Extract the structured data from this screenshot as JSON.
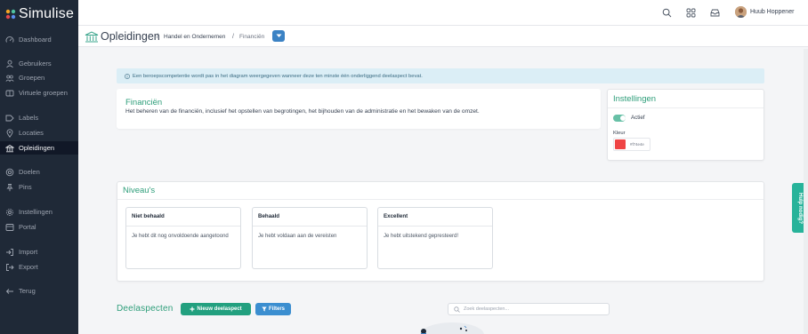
{
  "app": {
    "name": "Simulise"
  },
  "sidebar": {
    "items": [
      {
        "label": "Dashboard",
        "icon": "dashboard-icon"
      },
      {
        "label": "Gebruikers",
        "icon": "user-icon"
      },
      {
        "label": "Groepen",
        "icon": "group-icon"
      },
      {
        "label": "Virtuele groepen",
        "icon": "virtual-group-icon"
      },
      {
        "label": "Labels",
        "icon": "tag-icon"
      },
      {
        "label": "Locaties",
        "icon": "location-icon"
      },
      {
        "label": "Opleidingen",
        "icon": "education-icon",
        "active": true
      },
      {
        "label": "Doelen",
        "icon": "target-icon"
      },
      {
        "label": "Pins",
        "icon": "pin-icon"
      },
      {
        "label": "Instellingen",
        "icon": "gear-icon"
      },
      {
        "label": "Portal",
        "icon": "portal-icon"
      },
      {
        "label": "Import",
        "icon": "import-icon"
      },
      {
        "label": "Export",
        "icon": "export-icon"
      },
      {
        "label": "Terug",
        "icon": "back-arrow-icon"
      }
    ]
  },
  "topbar": {
    "icons": [
      "search-icon",
      "grid-apps-icon",
      "inbox-icon"
    ],
    "user_name": "Huub Hoppener"
  },
  "breadcrumb": {
    "title": "Opleidingen",
    "items": [
      "Handel en Ondernemen",
      "Financiën"
    ],
    "separator": "/"
  },
  "info_banner": {
    "text": "Een beroepscompetentie wordt pas in het diagram weergegeven wanneer deze ten minste één onderliggend deelaspect bevat."
  },
  "competence": {
    "title": "Financiën",
    "description": "Het beheren van de financiën, inclusief het opstellen van begrotingen, het bijhouden van de administratie en het bewaken van de omzet."
  },
  "settings": {
    "title": "Instellingen",
    "active_label": "Actief",
    "active": true,
    "color_label": "Kleur",
    "color_value": "#f74e4e",
    "swatch_color": "#ef4444"
  },
  "levels": {
    "title": "Niveau's",
    "items": [
      {
        "title": "Niet behaald",
        "text": "Je hebt dit nog onvoldoende aangetoond"
      },
      {
        "title": "Behaald",
        "text": "Je hebt voldaan aan de vereisten"
      },
      {
        "title": "Excellent",
        "text": "Je hebt uitstekend gepresteerd!"
      }
    ]
  },
  "subaspects": {
    "title": "Deelaspecten",
    "new_button": "Nieuw deelaspect",
    "filter_button": "Filters",
    "search_placeholder": "Zoek deelaspecten..."
  },
  "help": {
    "label": "Hulp nodig?"
  },
  "colors": {
    "accent": "#2e9e7a",
    "sidebar": "#1f2937",
    "primary_button": "#22a07f",
    "info_button": "#3b8ed0"
  }
}
